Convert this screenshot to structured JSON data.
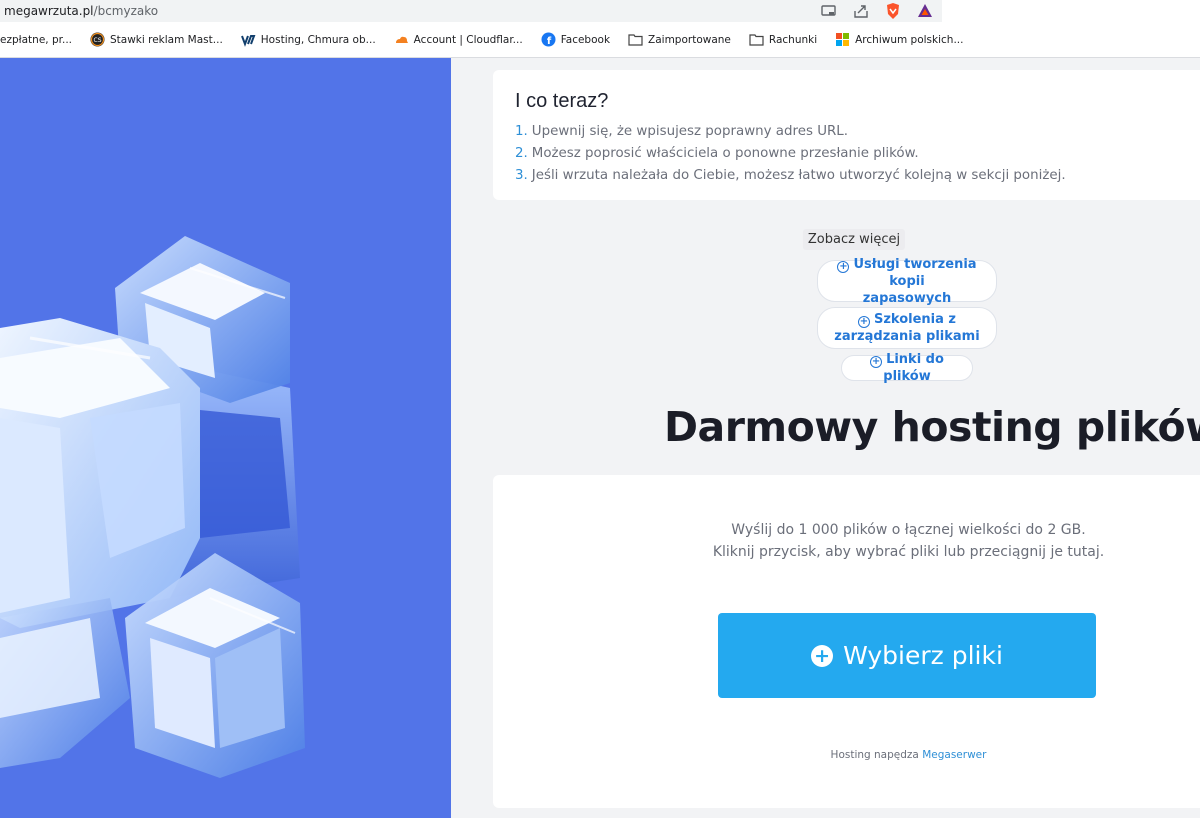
{
  "browser": {
    "url_host": "megawrzuta.pl",
    "url_path": "/bcmyzako",
    "bookmarks": [
      {
        "label": "ezpłatne, pr...",
        "icon": "none"
      },
      {
        "label": "Stawki reklam Mast...",
        "icon": "cs-badge-icon"
      },
      {
        "label": "Hosting, Chmura ob...",
        "icon": "ovh-logo-icon"
      },
      {
        "label": "Account | Cloudflar...",
        "icon": "cloudflare-icon"
      },
      {
        "label": "Facebook",
        "icon": "facebook-icon"
      },
      {
        "label": "Zaimportowane",
        "icon": "folder-icon"
      },
      {
        "label": "Rachunki",
        "icon": "folder-icon"
      },
      {
        "label": "Archiwum polskich...",
        "icon": "windows-logo-icon"
      }
    ]
  },
  "info": {
    "title": "I co teraz?",
    "items": [
      {
        "num": "1.",
        "text": "Upewnij się, że wpisujesz poprawny adres URL."
      },
      {
        "num": "2.",
        "text": "Możesz poprosić właściciela o ponowne przesłanie plików."
      },
      {
        "num": "3.",
        "text": "Jeśli wrzuta należała do Ciebie, możesz łatwo utworzyć kolejną w sekcji poniżej."
      }
    ]
  },
  "see_more": {
    "label": "Zobacz więcej",
    "links": [
      {
        "line1": "Usługi tworzenia kopii",
        "line2": "zapasowych"
      },
      {
        "line1": "Szkolenia z",
        "line2": "zarządzania plikami"
      },
      {
        "line1": "Linki do plików",
        "line2": ""
      }
    ]
  },
  "headline": "Darmowy hosting plików.",
  "upload": {
    "line1": "Wyślij do 1 000 plików o łącznej wielkości do 2 GB.",
    "line2": "Kliknij przycisk, aby wybrać pliki lub przeciągnij je tutaj.",
    "button_label": "Wybierz pliki",
    "footer_prefix": "Hosting napędza",
    "footer_link": "Megaserwer"
  },
  "colors": {
    "hero_bg": "#5274e8",
    "accent_button": "#24a9ef",
    "link_blue": "#2477d6"
  }
}
